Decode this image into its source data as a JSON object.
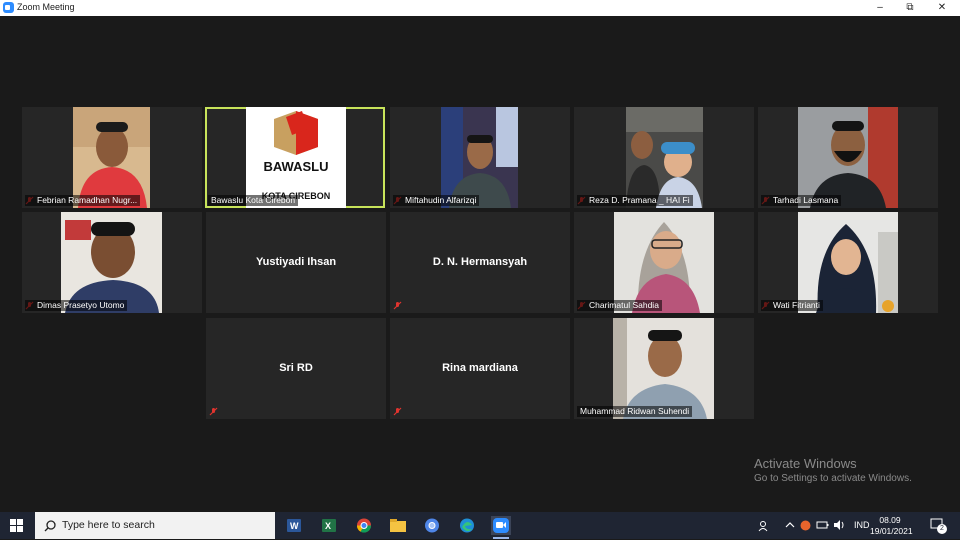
{
  "window": {
    "title": "Zoom Meeting",
    "minimize": "–",
    "maximize": "⧉",
    "close": "✕"
  },
  "participants": [
    {
      "id": "p1",
      "name": "Febrian Ramadhan Nugr...",
      "muted": true,
      "video": true
    },
    {
      "id": "p2",
      "name": "Bawaslu Kota Cirebon",
      "muted": false,
      "video": true,
      "active_speaker": true,
      "logo_text": "BAWASLU",
      "logo_sub": "KOTA CIREBON"
    },
    {
      "id": "p3",
      "name": "Miftahudin Alfarizqi",
      "muted": true,
      "video": true
    },
    {
      "id": "p4",
      "name": "Reza D. Pramana _ HAI Fi",
      "muted": true,
      "video": true
    },
    {
      "id": "p5",
      "name": "Tarhadi Lasmana",
      "muted": true,
      "video": true
    },
    {
      "id": "p6",
      "name": "Dimas Prasetyo Utomo",
      "muted": true,
      "video": true
    },
    {
      "id": "p7",
      "name": "Yustiyadi Ihsan",
      "muted": true,
      "video": false
    },
    {
      "id": "p8",
      "name": "D. N. Hermansyah",
      "muted": true,
      "video": false
    },
    {
      "id": "p9",
      "name": "Charimatul Sahdia",
      "muted": true,
      "video": true
    },
    {
      "id": "p10",
      "name": "Wati Fitrianti",
      "muted": true,
      "video": true
    },
    {
      "id": "p11",
      "name": "Sri RD",
      "muted": true,
      "video": false
    },
    {
      "id": "p12",
      "name": "Rina mardiana",
      "muted": true,
      "video": false
    },
    {
      "id": "p13",
      "name": "Muhammad Ridwan Suhendi",
      "muted": false,
      "video": true
    }
  ],
  "watermark": {
    "line1": "Activate Windows",
    "line2": "Go to Settings to activate Windows."
  },
  "taskbar": {
    "search_placeholder": "Type here to search",
    "apps": [
      "word-icon",
      "excel-icon",
      "chrome-icon",
      "file-explorer-icon",
      "chromium-icon",
      "edge-icon",
      "zoom-icon"
    ],
    "tray": {
      "language": "IND",
      "time": "08.09",
      "date": "19/01/2021",
      "notification_count": "2"
    }
  },
  "colors": {
    "active_speaker_border": "#c7e35a",
    "muted_mic": "#e0342f",
    "zoom_blue": "#2d8cff",
    "bawaslu_red": "#d9261c"
  }
}
